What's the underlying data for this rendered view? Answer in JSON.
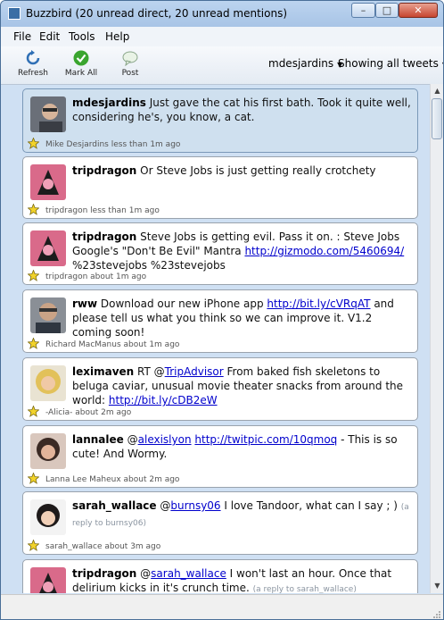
{
  "window": {
    "title": "Buzzbird (20 unread direct, 20 unread mentions)",
    "controls": {
      "minimize": "–",
      "maximize": "□",
      "close": "✕"
    }
  },
  "menu": [
    "File",
    "Edit",
    "Tools",
    "Help"
  ],
  "toolbar": {
    "refresh_label": "Refresh",
    "mark_all_label": "Mark All",
    "post_label": "Post",
    "account": "mdesjardins",
    "filter": "Showing all tweets"
  },
  "colors": {
    "link": "#0000cc",
    "selected_bg": "#cfe0ef",
    "star": "#f2d32a"
  },
  "tweets": [
    {
      "user": "mdesjardins",
      "text": " Just gave the cat his first bath. Took it quite well, considering he's, you know, a cat.",
      "meta": "Mike Desjardins less than 1m ago",
      "selected": true,
      "avatar": "cat-owner"
    },
    {
      "user": "tripdragon",
      "text": " Or Steve Jobs is just getting really crotchety",
      "meta": "tripdragon less than 1m ago",
      "avatar": "dragon"
    },
    {
      "user": "tripdragon",
      "text_before": " Steve Jobs is getting evil. Pass it on. : Steve Jobs Google's \"Don't Be Evil\" Mantra ",
      "link": "http://gizmodo.com/5460694/",
      "text_after": " %23stevejobs %23stevejobs",
      "meta": "tripdragon about 1m ago",
      "avatar": "dragon"
    },
    {
      "user": "rww",
      "text_before": " Download our new iPhone app ",
      "link": "http://bit.ly/cVRqAT",
      "text_after": " and please tell us what you think so we can improve it.  V1.2 coming soon!",
      "meta": "Richard MacManus about 1m ago",
      "avatar": "man"
    },
    {
      "user": "leximaven",
      "text_before": " RT @",
      "mention": "TripAdvisor",
      "text_mid": " From baked fish skeletons to beluga caviar, unusual movie theater snacks from around the world: ",
      "link": "http://bit.ly/cDB2eW",
      "meta": "-Alicia- about 2m ago",
      "avatar": "woman-blonde"
    },
    {
      "user": "lannalee",
      "text_before": " @",
      "mention": "alexislyon",
      "text_mid": " ",
      "link": "http://twitpic.com/10qmoq",
      "text_after": " - This is so cute! And Wormy.",
      "meta": "Lanna Lee Maheux about 2m ago",
      "avatar": "woman-dark"
    },
    {
      "user": "sarah_wallace",
      "text_before": " @",
      "mention": "burnsy06",
      "text_mid": " I love Tandoor, what can I say ; ) ",
      "reply": "(a reply to burnsy06)",
      "meta": "sarah_wallace about 3m ago",
      "avatar": "woman-asian"
    },
    {
      "user": "tripdragon",
      "text_before": " @",
      "mention": "sarah_wallace",
      "text_mid": " I won't last an hour. Once that delirium kicks in it's crunch time. ",
      "reply": "(a reply to sarah_wallace)",
      "meta": "",
      "avatar": "dragon"
    }
  ]
}
